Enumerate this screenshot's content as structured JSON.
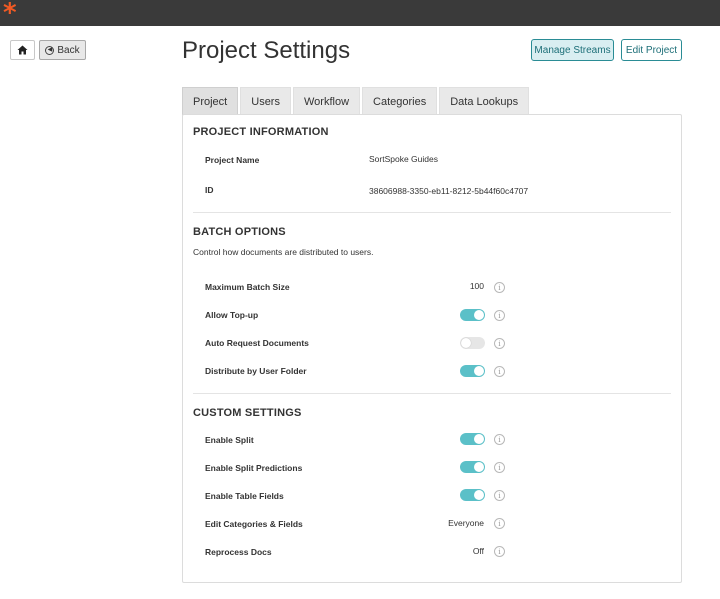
{
  "app": {
    "logo": "*"
  },
  "nav": {
    "home_icon": "home-icon",
    "back_label": "Back"
  },
  "header": {
    "title": "Project Settings",
    "manage_streams": "Manage Streams",
    "edit_project": "Edit Project"
  },
  "tabs": [
    {
      "label": "Project",
      "active": true
    },
    {
      "label": "Users",
      "active": false
    },
    {
      "label": "Workflow",
      "active": false
    },
    {
      "label": "Categories",
      "active": false
    },
    {
      "label": "Data Lookups",
      "active": false
    }
  ],
  "project_info": {
    "heading": "PROJECT INFORMATION",
    "rows": [
      {
        "label": "Project Name",
        "value": "SortSpoke Guides"
      },
      {
        "label": "ID",
        "value": "38606988-3350-eb11-8212-5b44f60c4707"
      }
    ]
  },
  "batch_options": {
    "heading": "BATCH OPTIONS",
    "description": "Control how documents are distributed to users.",
    "rows": [
      {
        "label": "Maximum Batch Size",
        "value": "100"
      },
      {
        "label": "Allow Top-up",
        "toggle": true
      },
      {
        "label": "Auto Request Documents",
        "toggle": false
      },
      {
        "label": "Distribute by User Folder",
        "toggle": true
      }
    ]
  },
  "custom_settings": {
    "heading": "CUSTOM SETTINGS",
    "rows": [
      {
        "label": "Enable Split",
        "toggle": true
      },
      {
        "label": "Enable Split Predictions",
        "toggle": true
      },
      {
        "label": "Enable Table Fields",
        "toggle": true
      },
      {
        "label": "Edit Categories & Fields",
        "value": "Everyone"
      },
      {
        "label": "Reprocess Docs",
        "value": "Off"
      }
    ]
  },
  "info_glyph": "i",
  "colors": {
    "accent": "#5bc0c8",
    "brand": "#f15a24",
    "topbar": "#3a3a3a",
    "button_border": "#2a8c95"
  }
}
